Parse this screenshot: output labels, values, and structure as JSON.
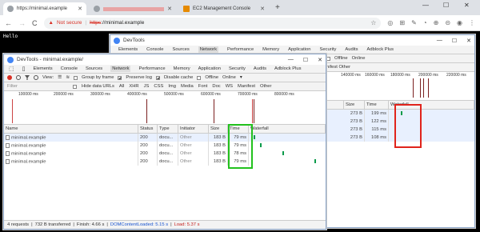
{
  "browser": {
    "tabs": [
      {
        "title": "https://minimal.example",
        "active": true
      },
      {
        "title": "",
        "active": false
      },
      {
        "title": "EC2 Management Console",
        "active": false
      }
    ],
    "newtab": "+",
    "nav": {
      "back": "←",
      "forward": "→",
      "reload": "C"
    },
    "omnibox": {
      "warning": "▲",
      "not_secure": "Not secure",
      "sep": "|",
      "scheme": "https",
      "rest": "://minimal.example"
    },
    "ext_icons": [
      "☆",
      "◎",
      "⊞",
      "✎",
      "◔",
      "⊕",
      "⊝",
      "◉",
      "⋮"
    ],
    "win_controls": [
      "—",
      "☐",
      "✕"
    ]
  },
  "page": {
    "hello": "Hello"
  },
  "back_devtools": {
    "title": "DevTools",
    "tabs": [
      "Elements",
      "Console",
      "Sources",
      "Network",
      "Performance",
      "Memory",
      "Application",
      "Security",
      "Audits",
      "Adblock Plus"
    ],
    "filter_row": [
      "Offline",
      "Online"
    ],
    "manifest_other": "Manifest  Other",
    "ticks": [
      "140000 ms",
      "160000 ms",
      "180000 ms",
      "200000 ms",
      "220000 ms"
    ],
    "columns": [
      "tor",
      "Size",
      "Time",
      "Waterfall"
    ],
    "rows": [
      {
        "size": "273 B",
        "time": "199 ms"
      },
      {
        "size": "273 B",
        "time": "122 ms"
      },
      {
        "size": "273 B",
        "time": "115 ms"
      },
      {
        "size": "273 B",
        "time": "108 ms"
      }
    ],
    "highlight_color": "#e0241c",
    "controls": [
      "—",
      "☐",
      "✕"
    ]
  },
  "front_devtools": {
    "title": "DevTools - minimal.example/",
    "controls": [
      "—",
      "☐",
      "✕"
    ],
    "tabs": [
      "Elements",
      "Console",
      "Sources",
      "Network",
      "Performance",
      "Memory",
      "Application",
      "Security",
      "Audits",
      "Adblock Plus"
    ],
    "active_tab": "Network",
    "options": {
      "view": "View:",
      "group_by_frame": "Group by frame",
      "preserve_log": "Preserve log",
      "disable_cache": "Disable cache",
      "offline": "Offline",
      "online": "Online"
    },
    "filter": {
      "placeholder": "Filter",
      "hide_data_urls": "Hide data URLs",
      "types": [
        "All",
        "XHR",
        "JS",
        "CSS",
        "Img",
        "Media",
        "Font",
        "Doc",
        "WS",
        "Manifest",
        "Other"
      ],
      "selected": "Doc"
    },
    "ticks": [
      "100000 ms",
      "200000 ms",
      "300000 ms",
      "400000 ms",
      "500000 ms",
      "600000 ms",
      "700000 ms",
      "800000 ms"
    ],
    "columns": [
      "Name",
      "Status",
      "Type",
      "Initiator",
      "Size",
      "Time",
      "Waterfall"
    ],
    "rows": [
      {
        "name": "minimal.example",
        "status": "200",
        "type": "docu...",
        "initiator": "Other",
        "size": "183 B",
        "time": "79 ms"
      },
      {
        "name": "minimal.example",
        "status": "200",
        "type": "docu...",
        "initiator": "Other",
        "size": "183 B",
        "time": "79 ms"
      },
      {
        "name": "minimal.example",
        "status": "200",
        "type": "docu...",
        "initiator": "Other",
        "size": "183 B",
        "time": "78 ms"
      },
      {
        "name": "minimal.example",
        "status": "200",
        "type": "docu...",
        "initiator": "Other",
        "size": "183 B",
        "time": "79 ms"
      }
    ],
    "status_bar": {
      "requests": "4 requests",
      "sep1": "|",
      "transferred": "732 B transferred",
      "sep2": "|",
      "finish": "Finish: 4.66 s",
      "sep3": "|",
      "dcl": "DOMContentLoaded: 5.15 s",
      "sep4": "|",
      "load": "Load: 5.37 s"
    },
    "highlight_color": "#22c11d"
  }
}
